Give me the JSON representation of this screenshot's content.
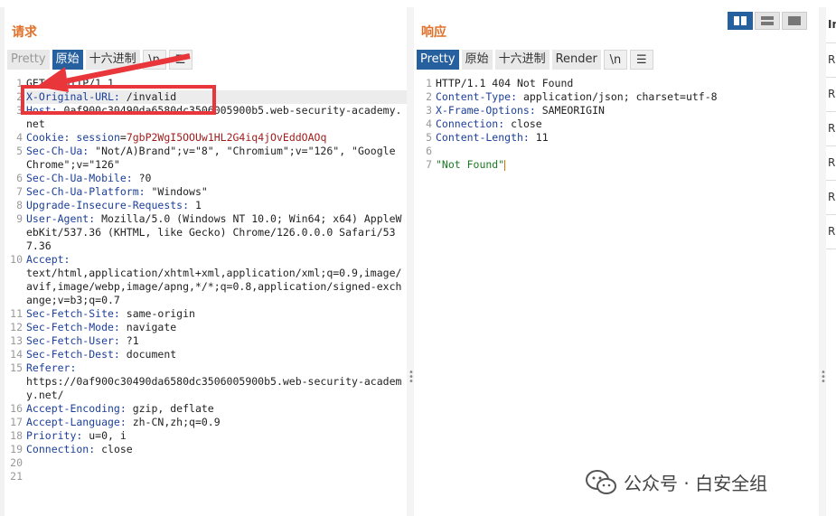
{
  "request": {
    "title": "请求",
    "tabs": [
      "Pretty",
      "原始",
      "十六进制",
      "\\n"
    ],
    "lines": [
      {
        "n": "1",
        "parts": [
          [
            "plain",
            "GET / HTTP/1.1"
          ]
        ]
      },
      {
        "n": "2",
        "parts": [
          [
            "name",
            "X-Original-URL:"
          ],
          [
            "plain",
            " /invalid"
          ]
        ]
      },
      {
        "n": "3",
        "parts": [
          [
            "name",
            "Host:"
          ],
          [
            "plain",
            " 0af900c30490da6580dc3506005900b5.web-security-academy.net"
          ]
        ]
      },
      {
        "n": "4",
        "parts": [
          [
            "name",
            "Cookie:"
          ],
          [
            "plain",
            " "
          ],
          [
            "name",
            "session"
          ],
          [
            "plain",
            "="
          ],
          [
            "cval",
            "7gbP2WgI5OOUw1HL2G4iq4jOvEddOAOq"
          ]
        ]
      },
      {
        "n": "5",
        "parts": [
          [
            "name",
            "Sec-Ch-Ua:"
          ],
          [
            "plain",
            " \"Not/A)Brand\";v=\"8\", \"Chromium\";v=\"126\", \"Google Chrome\";v=\"126\""
          ]
        ]
      },
      {
        "n": "6",
        "parts": [
          [
            "name",
            "Sec-Ch-Ua-Mobile:"
          ],
          [
            "plain",
            " ?0"
          ]
        ]
      },
      {
        "n": "7",
        "parts": [
          [
            "name",
            "Sec-Ch-Ua-Platform:"
          ],
          [
            "plain",
            " \"Windows\""
          ]
        ]
      },
      {
        "n": "8",
        "parts": [
          [
            "name",
            "Upgrade-Insecure-Requests:"
          ],
          [
            "plain",
            " 1"
          ]
        ]
      },
      {
        "n": "9",
        "parts": [
          [
            "name",
            "User-Agent:"
          ],
          [
            "plain",
            " Mozilla/5.0 (Windows NT 10.0; Win64; x64) AppleWebKit/537.36 (KHTML, like Gecko) Chrome/126.0.0.0 Safari/537.36"
          ]
        ]
      },
      {
        "n": "10",
        "parts": [
          [
            "name",
            "Accept:"
          ],
          [
            "plain",
            "\ntext/html,application/xhtml+xml,application/xml;q=0.9,image/avif,image/webp,image/apng,*/*;q=0.8,application/signed-exchange;v=b3;q=0.7"
          ]
        ]
      },
      {
        "n": "11",
        "parts": [
          [
            "name",
            "Sec-Fetch-Site:"
          ],
          [
            "plain",
            " same-origin"
          ]
        ]
      },
      {
        "n": "12",
        "parts": [
          [
            "name",
            "Sec-Fetch-Mode:"
          ],
          [
            "plain",
            " navigate"
          ]
        ]
      },
      {
        "n": "13",
        "parts": [
          [
            "name",
            "Sec-Fetch-User:"
          ],
          [
            "plain",
            " ?1"
          ]
        ]
      },
      {
        "n": "14",
        "parts": [
          [
            "name",
            "Sec-Fetch-Dest:"
          ],
          [
            "plain",
            " document"
          ]
        ]
      },
      {
        "n": "15",
        "parts": [
          [
            "name",
            "Referer:"
          ],
          [
            "plain",
            "\nhttps://0af900c30490da6580dc3506005900b5.web-security-academy.net/"
          ]
        ]
      },
      {
        "n": "16",
        "parts": [
          [
            "name",
            "Accept-Encoding:"
          ],
          [
            "plain",
            " gzip, deflate"
          ]
        ]
      },
      {
        "n": "17",
        "parts": [
          [
            "name",
            "Accept-Language:"
          ],
          [
            "plain",
            " zh-CN,zh;q=0.9"
          ]
        ]
      },
      {
        "n": "18",
        "parts": [
          [
            "name",
            "Priority:"
          ],
          [
            "plain",
            " u=0, i"
          ]
        ]
      },
      {
        "n": "19",
        "parts": [
          [
            "name",
            "Connection:"
          ],
          [
            "plain",
            " close"
          ]
        ]
      },
      {
        "n": "20",
        "parts": []
      },
      {
        "n": "21",
        "parts": []
      }
    ]
  },
  "response": {
    "title": "响应",
    "tabs": [
      "Pretty",
      "原始",
      "十六进制",
      "Render",
      "\\n"
    ],
    "lines": [
      {
        "n": "1",
        "parts": [
          [
            "plain",
            "HTTP/1.1 404 Not Found"
          ]
        ]
      },
      {
        "n": "2",
        "parts": [
          [
            "name",
            "Content-Type:"
          ],
          [
            "plain",
            " application/json; charset=utf-8"
          ]
        ]
      },
      {
        "n": "3",
        "parts": [
          [
            "name",
            "X-Frame-Options:"
          ],
          [
            "plain",
            " SAMEORIGIN"
          ]
        ]
      },
      {
        "n": "4",
        "parts": [
          [
            "name",
            "Connection:"
          ],
          [
            "plain",
            " close"
          ]
        ]
      },
      {
        "n": "5",
        "parts": [
          [
            "name",
            "Content-Length:"
          ],
          [
            "plain",
            " 11"
          ]
        ]
      },
      {
        "n": "6",
        "parts": []
      },
      {
        "n": "7",
        "parts": [
          [
            "str",
            "\"Not Found\""
          ]
        ]
      }
    ]
  },
  "inspector": {
    "items": [
      "In",
      "R",
      "R",
      "R",
      "R",
      "R",
      "R"
    ]
  },
  "watermark": {
    "text": "公众号 · 白安全组"
  },
  "colors": {
    "accent": "#27609e",
    "title": "#e0702a",
    "header_name": "#1c3f9a",
    "annotation": "#e8363a"
  }
}
